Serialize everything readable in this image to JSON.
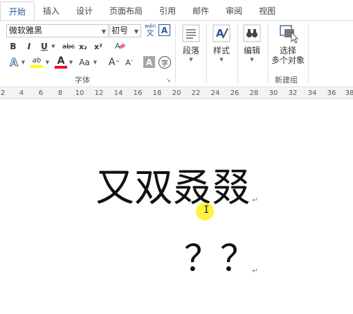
{
  "tabs": [
    "开始",
    "插入",
    "设计",
    "页面布局",
    "引用",
    "邮件",
    "审阅",
    "视图"
  ],
  "ribbon": {
    "font_name": "微软雅黑",
    "font_size": "初号",
    "phonetic": "wén",
    "bold": "B",
    "italic": "I",
    "underline": "U",
    "strikethrough": "abc",
    "subscript": "x₂",
    "superscript": "x²",
    "text_effect": "A",
    "highlight": "ab",
    "font_color": "A",
    "change_case": "Aa",
    "grow_font": "A",
    "shrink_font": "A",
    "char_shading": "A",
    "enclose": "字",
    "group_font_label": "字体",
    "paragraph_label": "段落",
    "styles_label": "样式",
    "editing_label": "编辑",
    "select_label_1": "选择",
    "select_label_2": "多个对象",
    "newgroup_label": "新建组",
    "accent_color": "#2b579a"
  },
  "ruler": {
    "ticks": [
      "2",
      "4",
      "6",
      "8",
      "10",
      "12",
      "14",
      "16",
      "18",
      "20",
      "22",
      "24",
      "26",
      "28",
      "30",
      "32",
      "34",
      "36",
      "38"
    ]
  },
  "document": {
    "line1": "又双叒叕",
    "line2": "？？",
    "para_mark": "↵"
  }
}
